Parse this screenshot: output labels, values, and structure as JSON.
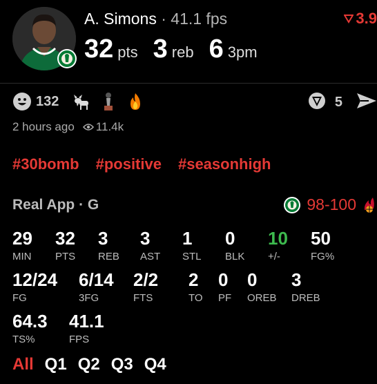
{
  "player": {
    "name": "A. Simons",
    "separator": "·",
    "fps_text": "41.1 fps",
    "rank_value": "3.9"
  },
  "statline": [
    {
      "value": "32",
      "unit": "pts"
    },
    {
      "value": "3",
      "unit": "reb"
    },
    {
      "value": "6",
      "unit": "3pm"
    }
  ],
  "reactions": {
    "emoji_count": "132",
    "share_count": "5",
    "icons": [
      "smiley-icon",
      "goat-icon",
      "trophy-icon",
      "fire-icon"
    ]
  },
  "meta": {
    "time_ago": "2 hours ago",
    "views": "11.4k"
  },
  "tags": [
    "#30bomb",
    "#positive",
    "#seasonhigh"
  ],
  "game": {
    "source": "Real App · G",
    "score": "98-100"
  },
  "box_score": {
    "row1": [
      {
        "value": "29",
        "label": "MIN"
      },
      {
        "value": "32",
        "label": "PTS"
      },
      {
        "value": "3",
        "label": "REB"
      },
      {
        "value": "3",
        "label": "AST"
      },
      {
        "value": "1",
        "label": "STL"
      },
      {
        "value": "0",
        "label": "BLK"
      },
      {
        "value": "10",
        "label": "+/-"
      },
      {
        "value": "50",
        "label": "FG%"
      }
    ],
    "row2": [
      {
        "value": "12/24",
        "label": "FG"
      },
      {
        "value": "6/14",
        "label": "3FG"
      },
      {
        "value": "2/2",
        "label": "FTS"
      },
      {
        "value": "2",
        "label": "TO"
      },
      {
        "value": "0",
        "label": "PF"
      },
      {
        "value": "0",
        "label": "OREB"
      },
      {
        "value": "3",
        "label": "DREB"
      }
    ],
    "row3": [
      {
        "value": "64.3",
        "label": "TS%"
      },
      {
        "value": "41.1",
        "label": "FPS"
      }
    ]
  },
  "periods": [
    "All",
    "Q1",
    "Q2",
    "Q3",
    "Q4"
  ],
  "colors": {
    "accent_red": "#e53935",
    "positive_green": "#3dba4e",
    "celtics_green": "#007a33"
  }
}
